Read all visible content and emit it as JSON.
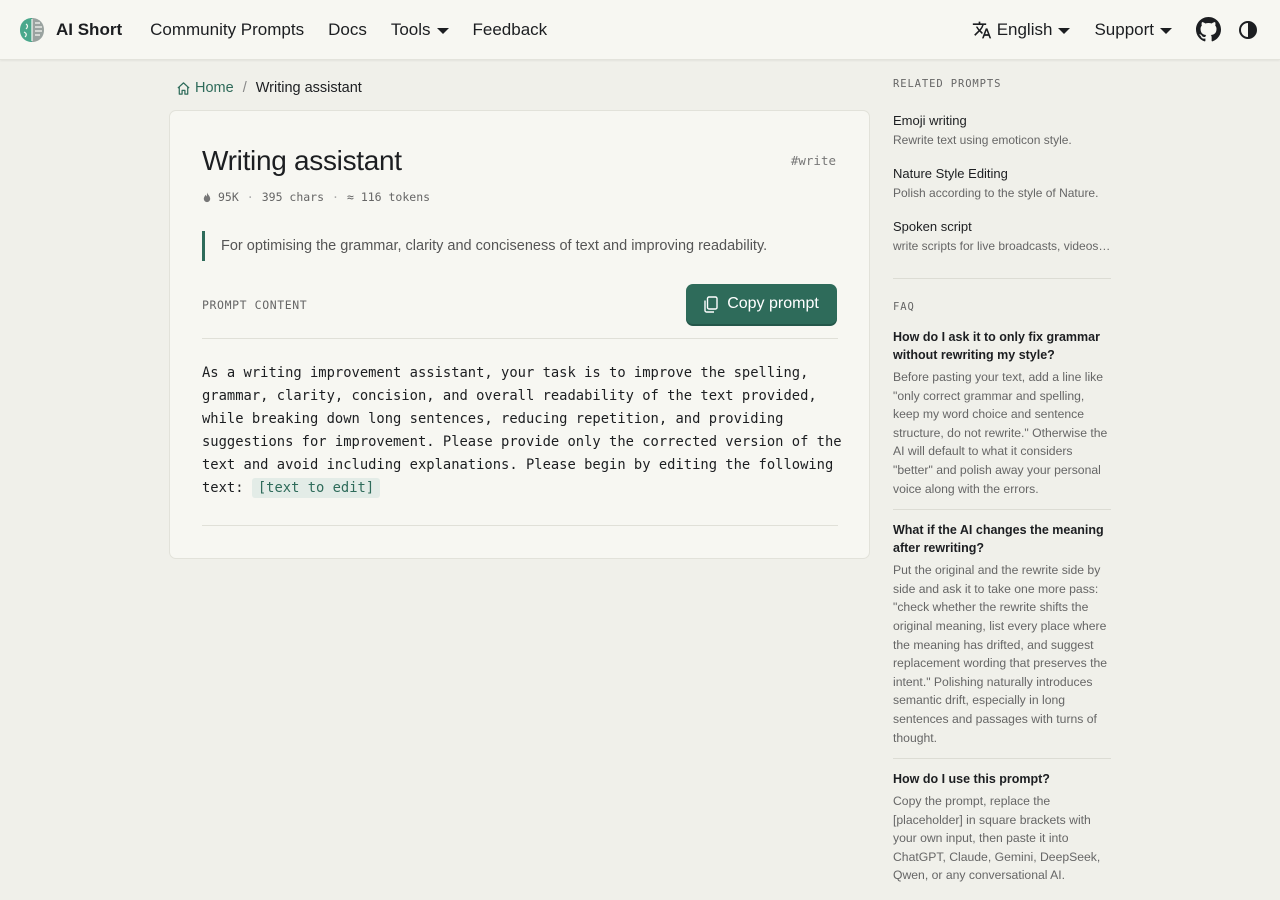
{
  "navbar": {
    "brand": "AI Short",
    "links": [
      {
        "label": "Community Prompts"
      },
      {
        "label": "Docs"
      },
      {
        "label": "Tools",
        "dropdown": true
      },
      {
        "label": "Feedback"
      }
    ],
    "language": "English",
    "support": "Support",
    "icons": [
      "translate-icon",
      "github-icon",
      "theme-toggle-icon"
    ]
  },
  "breadcrumb": {
    "home": "Home",
    "current": "Writing assistant"
  },
  "prompt": {
    "title": "Writing assistant",
    "tag": "#write",
    "views": "95K",
    "chars": "395 chars",
    "tokens": "≈ 116 tokens",
    "description": "For optimising the grammar, clarity and conciseness of text and improving readability.",
    "section_label": "PROMPT CONTENT",
    "copy_label": "Copy prompt",
    "body": "As a writing improvement assistant, your task is to improve the spelling, grammar, clarity, concision, and overall readability of the text provided, while breaking down long sentences, reducing repetition, and providing suggestions for improvement. Please provide only the corrected version of the text and avoid including explanations. Please begin by editing the following text:",
    "placeholder": "[text to edit]"
  },
  "sidebar": {
    "related_label": "RELATED PROMPTS",
    "related": [
      {
        "title": "Emoji writing",
        "desc": "Rewrite text using emoticon style."
      },
      {
        "title": "Nature Style Editing",
        "desc": "Polish according to the style of Nature."
      },
      {
        "title": "Spoken script",
        "desc": "write scripts for live broadcasts, videos and speeches."
      }
    ],
    "faq_label": "FAQ",
    "faq": [
      {
        "q": "How do I ask it to only fix grammar without rewriting my style?",
        "a": "Before pasting your text, add a line like \"only correct grammar and spelling, keep my word choice and sentence structure, do not rewrite.\" Otherwise the AI will default to what it considers \"better\" and polish away your personal voice along with the errors."
      },
      {
        "q": "What if the AI changes the meaning after rewriting?",
        "a": "Put the original and the rewrite side by side and ask it to take one more pass: \"check whether the rewrite shifts the original meaning, list every place where the meaning has drifted, and suggest replacement wording that preserves the intent.\" Polishing naturally introduces semantic drift, especially in long sentences and passages with turns of thought."
      },
      {
        "q": "How do I use this prompt?",
        "a": "Copy the prompt, replace the [placeholder] in square brackets with your own input, then paste it into ChatGPT, Claude, Gemini, DeepSeek, Qwen, or any conversational AI."
      }
    ]
  }
}
